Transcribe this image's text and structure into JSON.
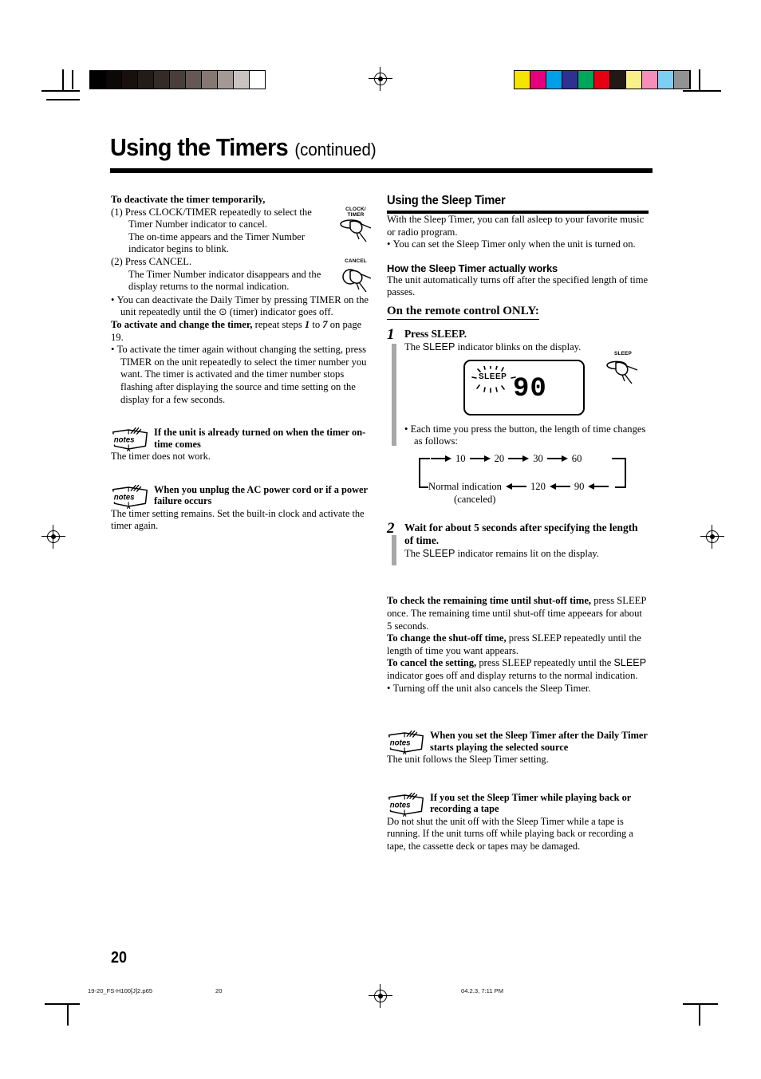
{
  "page": {
    "title_main": "Using the Timers",
    "title_suffix": "(continued)",
    "page_number": "20"
  },
  "footer": {
    "filename": "19-20_FS-H100[J]2.p65",
    "page": "20",
    "datetime": "04.2.3, 7:11 PM"
  },
  "printmarks": {
    "gray_wedge": [
      "#000000",
      "#0c0807",
      "#17100e",
      "#241b18",
      "#342a26",
      "#4a3e39",
      "#655852",
      "#857873",
      "#a39a96",
      "#cac3c0",
      "#ffffff"
    ],
    "color_bars": [
      "#f5e400",
      "#e5007f",
      "#00a0e9",
      "#2e3192",
      "#00a65a",
      "#e60012",
      "#231815",
      "#faf08a",
      "#f58fba",
      "#7ecef4",
      "#929292"
    ]
  },
  "left_column": {
    "deactivate_heading": "To deactivate the timer temporarily,",
    "step1_line1": "(1) Press CLOCK/TIMER repeatedly to select the",
    "step1_line2": "Timer Number indicator to cancel.",
    "step1_line3": "The on-time appears and the Timer Number",
    "step1_line4": "indicator begins to blink.",
    "step2_line1": "(2) Press CANCEL.",
    "step2_line2": "The Timer Number indicator disappears and the",
    "step2_line3": "display returns to the normal indication.",
    "bullet_deactivate": "You can deactivate the Daily Timer by pressing TIMER on the unit repeatedly until the ⊙ (timer) indicator goes off.",
    "activate_bold": "To activate and change the timer,",
    "activate_rest_a": "repeat steps",
    "activate_step_from": "1",
    "activate_to": "to",
    "activate_step_to": "7",
    "activate_rest_b": "on page 19.",
    "activate_bullet": "To activate the timer again without changing the setting, press TIMER on the unit repeatedly to select the timer number you want. The timer is activated and the timer number stops flashing after displaying the source and time setting on the display for a few seconds.",
    "note1_head": "If the unit is already turned on when the timer on-time comes",
    "note1_body": "The timer does not work.",
    "note2_head": "When you unplug the AC power cord or if a power failure occurs",
    "note2_body": "The timer setting remains. Set the built-in clock and activate the timer again.",
    "icon_clock_timer_label": "CLOCK/\nTIMER",
    "icon_cancel_label": "CANCEL",
    "notes_badge_text": "notes"
  },
  "right_column": {
    "section_title": "Using the Sleep Timer",
    "intro": "With the Sleep Timer, you can fall asleep to your favorite music or radio program.",
    "intro_bullet": "You can set the Sleep Timer only when the unit is turned on.",
    "how_heading": "How the Sleep Timer actually works",
    "how_body": "The unit automatically turns off after the specified length of time passes.",
    "remote_only": "On the remote control ONLY:",
    "step1_num": "1",
    "step1_head": "Press SLEEP.",
    "step1_body": "The SLEEP indicator blinks on the display.",
    "step1_sleep_word": "SLEEP",
    "lcd_label": "SLEEP",
    "lcd_value": "90",
    "each_time_bullet": "Each time you press the button, the length of time changes as follows:",
    "flow_top": [
      "10",
      "20",
      "30",
      "60"
    ],
    "flow_bottom": [
      "120",
      "90"
    ],
    "flow_normal": "Normal indication",
    "flow_canceled": "(canceled)",
    "step2_num": "2",
    "step2_head": "Wait for about 5 seconds after specifying the length of time.",
    "step2_body_pre": "The ",
    "step2_body_sleep": "SLEEP",
    "step2_body_post": " indicator remains lit on the display.",
    "check_bold": "To check the remaining time until shut-off time,",
    "check_rest": "press SLEEP once. The remaining time until shut-off time appeears for about 5 seconds.",
    "change_bold": "To change the shut-off time,",
    "change_rest": "press SLEEP repeatedly until the length of time you want appears.",
    "cancel_bold": "To cancel the setting,",
    "cancel_rest_pre": "press SLEEP repeatedly until the ",
    "cancel_sleep_word": "SLEEP",
    "cancel_rest_post": " indicator goes off and display returns to the normal indication.",
    "cancel_bullet": "Turning off the unit also cancels the Sleep Timer.",
    "note1_head": "When you set the Sleep Timer after the Daily Timer starts playing the selected source",
    "note1_body": "The unit follows the Sleep Timer setting.",
    "note2_head": "If you set the Sleep Timer while playing back or recording a tape",
    "note2_body": "Do not shut the unit off with the Sleep Timer while a tape is running. If the unit turns off while playing back or recording a tape, the cassette deck or tapes may be damaged.",
    "icon_sleep_label": "SLEEP"
  }
}
